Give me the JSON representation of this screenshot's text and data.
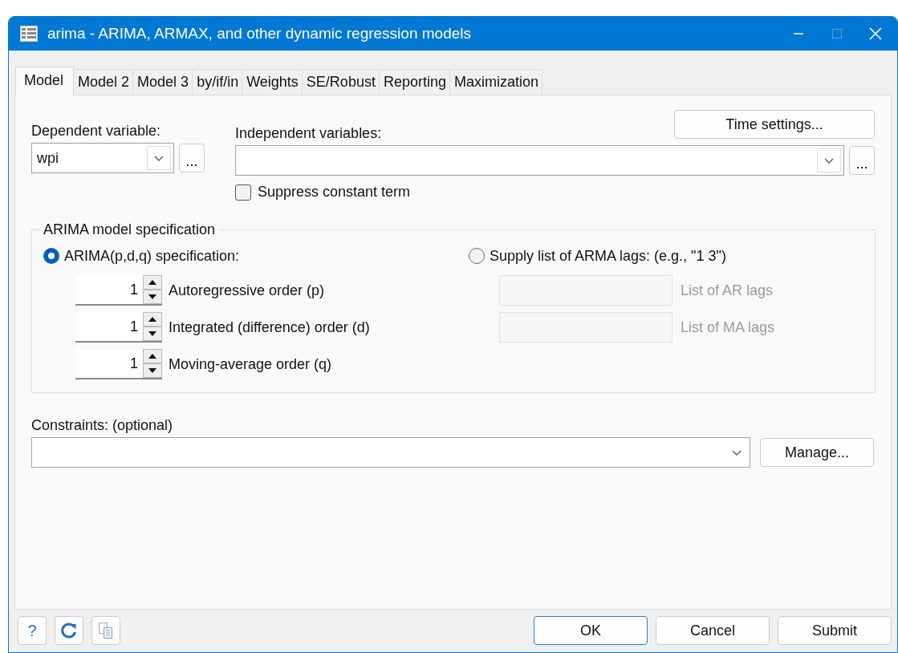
{
  "window": {
    "title": "arima - ARIMA, ARMAX, and other dynamic regression models"
  },
  "tabs": [
    {
      "label": "Model",
      "selected": true
    },
    {
      "label": "Model 2",
      "selected": false
    },
    {
      "label": "Model 3",
      "selected": false
    },
    {
      "label": "by/if/in",
      "selected": false
    },
    {
      "label": "Weights",
      "selected": false
    },
    {
      "label": "SE/Robust",
      "selected": false
    },
    {
      "label": "Reporting",
      "selected": false
    },
    {
      "label": "Maximization",
      "selected": false
    }
  ],
  "dependent_variable": {
    "label": "Dependent variable:",
    "value": "wpi",
    "browse": "..."
  },
  "independent_variables": {
    "label": "Independent variables:",
    "browse": "..."
  },
  "time_settings_button": "Time settings...",
  "suppress_constant": {
    "label": "Suppress constant term",
    "checked": false
  },
  "arima_group": {
    "title": "ARIMA model specification",
    "options": [
      {
        "label": "ARIMA(p,d,q) specification:",
        "selected": true
      },
      {
        "label": "Supply list of ARMA lags: (e.g., \"1 3\")",
        "selected": false
      }
    ],
    "orders": [
      {
        "value": "1",
        "label": "Autoregressive order (p)"
      },
      {
        "value": "1",
        "label": "Integrated (difference) order (d)"
      },
      {
        "value": "1",
        "label": "Moving-average order (q)"
      }
    ],
    "lag_lists": [
      {
        "label": "List of AR lags",
        "disabled": true
      },
      {
        "label": "List of MA lags",
        "disabled": true
      }
    ]
  },
  "constraints": {
    "label": "Constraints: (optional)",
    "manage_button": "Manage..."
  },
  "footer": {
    "help": "?",
    "buttons": [
      {
        "label": "OK",
        "default": true
      },
      {
        "label": "Cancel",
        "default": false
      },
      {
        "label": "Submit",
        "default": false
      }
    ]
  }
}
